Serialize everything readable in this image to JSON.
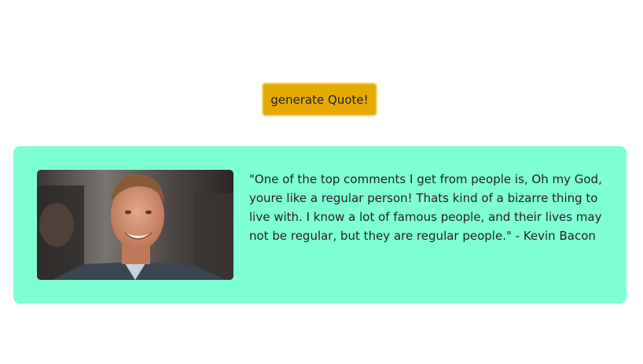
{
  "button": {
    "label": "generate Quote!",
    "color": "#e5ab04"
  },
  "quote": {
    "text": "\"One of the top comments I get from people is, Oh my God, youre like a regular person! Thats kind of a bizarre thing to live with. I know a lot of famous people, and their lives may not be regular, but they are regular people.\" - Kevin Bacon",
    "card_color": "#7fffd4"
  },
  "image": {
    "icon": "portrait-photo"
  }
}
